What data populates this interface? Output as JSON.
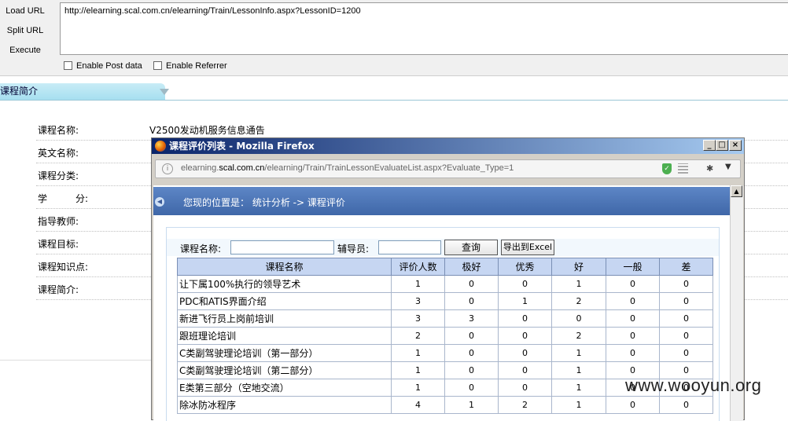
{
  "hackbar": {
    "load_url": "Load URL",
    "split_url": "Split URL",
    "execute": "Execute",
    "url_value": "http://elearning.scal.com.cn/elearning/Train/LessonInfo.aspx?LessonID=1200",
    "enable_post": "Enable Post data",
    "enable_referrer": "Enable Referrer"
  },
  "background_page": {
    "tab_title": "课程简介",
    "fields": [
      {
        "label": "课程名称:",
        "value": "V2500发动机服务信息通告"
      },
      {
        "label": "英文名称:",
        "value": ""
      },
      {
        "label": "课程分类:",
        "value": ""
      },
      {
        "label": "学　　　分:",
        "value": ""
      },
      {
        "label": "指导教师:",
        "value": ""
      },
      {
        "label": "课程目标:",
        "value": ""
      },
      {
        "label": "课程知识点:",
        "value": ""
      },
      {
        "label": "课程简介:",
        "value": ""
      }
    ]
  },
  "popup": {
    "window_title": "课程评价列表 - Mozilla Firefox",
    "url_prefix": "elearning.",
    "url_domain": "scal.com.cn",
    "url_rest": "/elearning/Train/TrainLessonEvaluateList.aspx?Evaluate_Type=1",
    "location_prefix": "您现的位置是：",
    "location_path": "统计分析  ->  课程评价",
    "search": {
      "course_label": "课程名称:",
      "tutor_label": "辅导员:",
      "query_button": "查询",
      "export_button": "导出到Excel"
    },
    "table": {
      "headers": [
        "课程名称",
        "评价人数",
        "极好",
        "优秀",
        "好",
        "一般",
        "差"
      ],
      "rows": [
        [
          "让下属100%执行的领导艺术",
          "1",
          "0",
          "0",
          "1",
          "0",
          "0"
        ],
        [
          "PDC和ATIS界面介绍",
          "3",
          "0",
          "1",
          "2",
          "0",
          "0"
        ],
        [
          "新进飞行员上岗前培训",
          "3",
          "3",
          "0",
          "0",
          "0",
          "0"
        ],
        [
          "跟班理论培训",
          "2",
          "0",
          "0",
          "2",
          "0",
          "0"
        ],
        [
          "C类副驾驶理论培训（第一部分）",
          "1",
          "0",
          "0",
          "1",
          "0",
          "0"
        ],
        [
          "C类副驾驶理论培训（第二部分）",
          "1",
          "0",
          "0",
          "1",
          "0",
          "0"
        ],
        [
          "E类第三部分（空地交流）",
          "1",
          "0",
          "0",
          "1",
          "0",
          "0"
        ],
        [
          "除冰防冰程序",
          "4",
          "1",
          "2",
          "1",
          "0",
          "0"
        ]
      ]
    }
  },
  "watermark": "www.wooyun.org",
  "colors": {
    "titlebar_start": "#0a246a",
    "titlebar_end": "#a6caf0",
    "location_bar": "#4a72b4",
    "table_header": "#c6d6f2"
  }
}
